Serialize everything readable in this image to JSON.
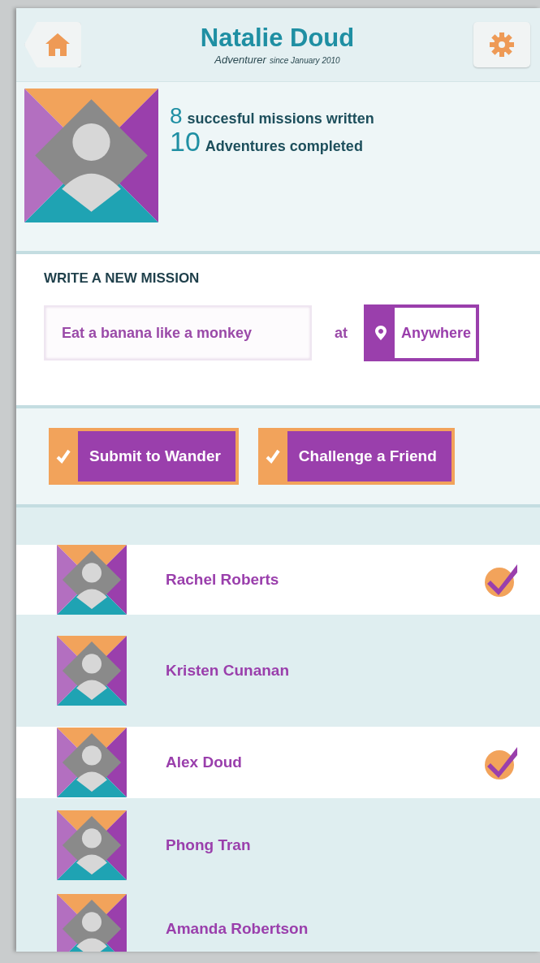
{
  "header": {
    "title": "Natalie Doud",
    "role": "Adventurer",
    "since": "since January 2010"
  },
  "stats": [
    {
      "count": "8",
      "label": "succesful missions written"
    },
    {
      "count": "10",
      "label": "Adventures completed"
    }
  ],
  "mission": {
    "heading": "WRITE A NEW MISSION",
    "value": "Eat a banana like a monkey",
    "connector": "at",
    "location": "Anywhere"
  },
  "options": [
    {
      "label": "Submit to Wander",
      "checked": true
    },
    {
      "label": "Challenge a Friend",
      "checked": true
    }
  ],
  "friends": [
    {
      "name": "Rachel Roberts",
      "selected": true
    },
    {
      "name": "Kristen Cunanan",
      "selected": false
    },
    {
      "name": "Alex Doud",
      "selected": true
    },
    {
      "name": "Phong Tran",
      "selected": false
    },
    {
      "name": "Amanda Robertson",
      "selected": false
    }
  ]
}
